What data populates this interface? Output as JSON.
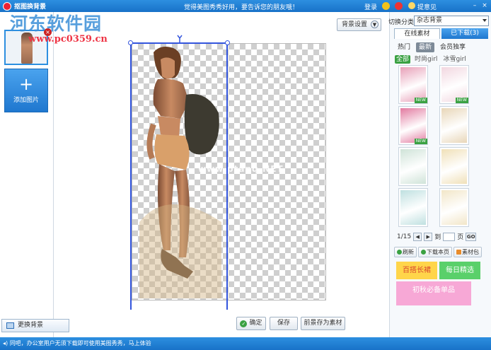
{
  "app": {
    "title": "抠图换背景",
    "notice": "觉得美图秀秀好用，要告诉您的朋友哦！",
    "login": "登录",
    "feedback": "提意见",
    "window_controls": {
      "minimize": "–",
      "close": "×"
    }
  },
  "watermark": {
    "name": "河东软件园",
    "url": "www.pc0359.cn",
    "canvas_mark": "www.ptanq.NET"
  },
  "left": {
    "add_image": "添加图片",
    "change_bg": "更换背景"
  },
  "toolbar": {
    "bg_settings": "背景设置"
  },
  "actions": {
    "confirm": "确定",
    "save": "保存",
    "save_as_material": "前景存为素材"
  },
  "right": {
    "category_label": "切换分类",
    "category_value": "杂志背景",
    "tabs": [
      "在线素材",
      "已下载(3)"
    ],
    "subtabs": [
      "热门",
      "最新",
      "会员独享"
    ],
    "active_subtab": "最新",
    "filters": [
      "全部",
      "时尚girl",
      "冰雪girl"
    ],
    "active_filter": "全部",
    "materials": [
      {
        "name": "magazine-1",
        "color": "#e8a0b8",
        "new": true
      },
      {
        "name": "magazine-2",
        "color": "#f2d7e0",
        "new": true
      },
      {
        "name": "magazine-3",
        "color": "#e27aa0",
        "new": true
      },
      {
        "name": "magazine-4",
        "color": "#e8d6b8",
        "new": false
      },
      {
        "name": "magazine-5",
        "color": "#cfe3d8",
        "new": false
      },
      {
        "name": "magazine-6",
        "color": "#f0e0b8",
        "new": false
      },
      {
        "name": "magazine-7",
        "color": "#bfe0e0",
        "new": false
      },
      {
        "name": "magazine-8",
        "color": "#f2e6c8",
        "new": false
      }
    ],
    "new_badge": "NEW",
    "pager": {
      "current": "1/15",
      "prev": "◀",
      "next": "▶",
      "to_label": "到",
      "page_label": "页",
      "go": "GO"
    },
    "tools": [
      "刷新",
      "下载本页",
      "素材包"
    ],
    "promos": [
      "百搭长裙",
      "每日精选",
      "初秋必备单品"
    ]
  },
  "status": {
    "text": "同吧，办公室用户无须下载即可使用美图秀秀，马上体验"
  },
  "colors": {
    "accent": "#1f77cf",
    "selection": "#3355dd",
    "ok": "#3aa142"
  }
}
